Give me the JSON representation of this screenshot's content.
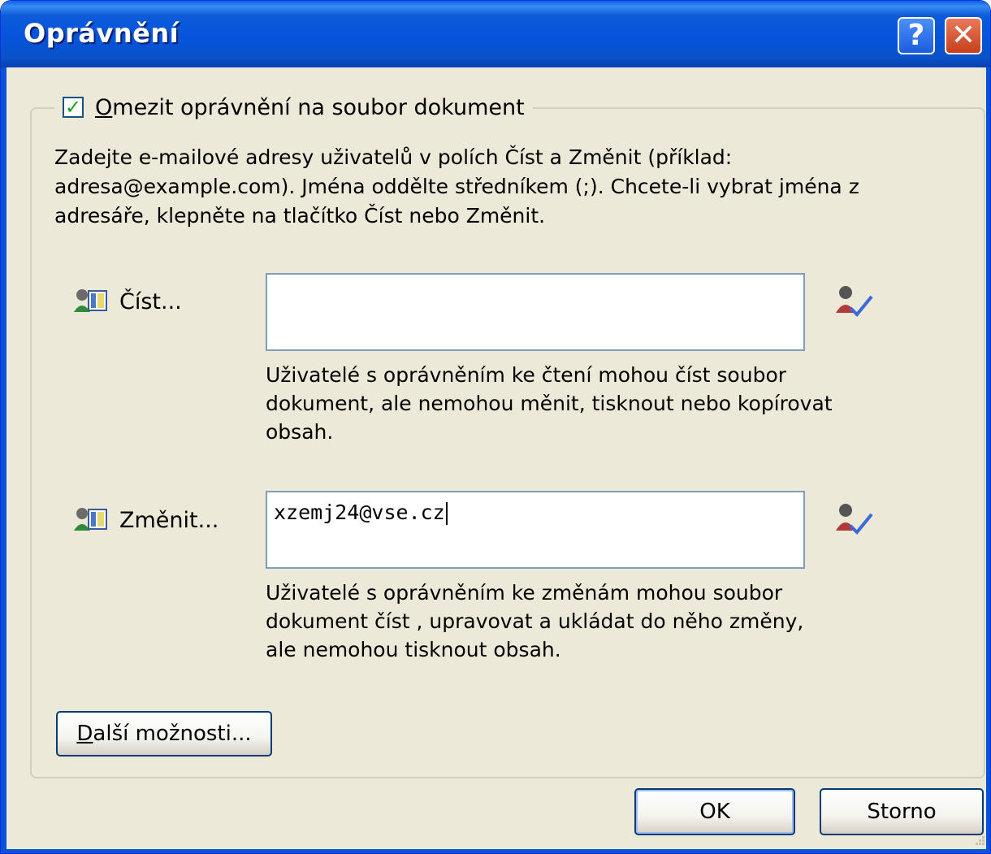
{
  "window": {
    "title": "Oprávnění",
    "help_label": "?",
    "close_label": "✕"
  },
  "restrict": {
    "checked": true,
    "mnemonic": "O",
    "label_rest": "mezit oprávnění na soubor dokument"
  },
  "instructions": "Zadejte e-mailové adresy uživatelů v polích Číst a Změnit (příklad: adresa@example.com). Jména oddělte středníkem (;). Chcete-li vybrat jména z adresáře, klepněte na tlačítko Číst nebo Změnit.",
  "read": {
    "label": "Číst...",
    "value": "",
    "description": "Uživatelé s oprávněním ke čtení mohou číst soubor dokument, ale nemohou měnit, tisknout nebo kopírovat obsah."
  },
  "change": {
    "label": "Změnit...",
    "value": "xzemj24@vse.cz",
    "description": "Uživatelé s oprávněním ke změnám mohou soubor dokument číst , upravovat a ukládat do něho změny, ale nemohou tisknout obsah."
  },
  "buttons": {
    "more_mnemonic": "D",
    "more_rest": "alší možnosti...",
    "ok": "OK",
    "cancel": "Storno"
  },
  "icons": {
    "address_book": "address-book-icon",
    "check_names": "check-names-icon"
  },
  "colors": {
    "title_bar": "#0554dc",
    "dialog_bg": "#ece9d8",
    "close_red": "#c73f1c",
    "check_green": "#21a121"
  }
}
